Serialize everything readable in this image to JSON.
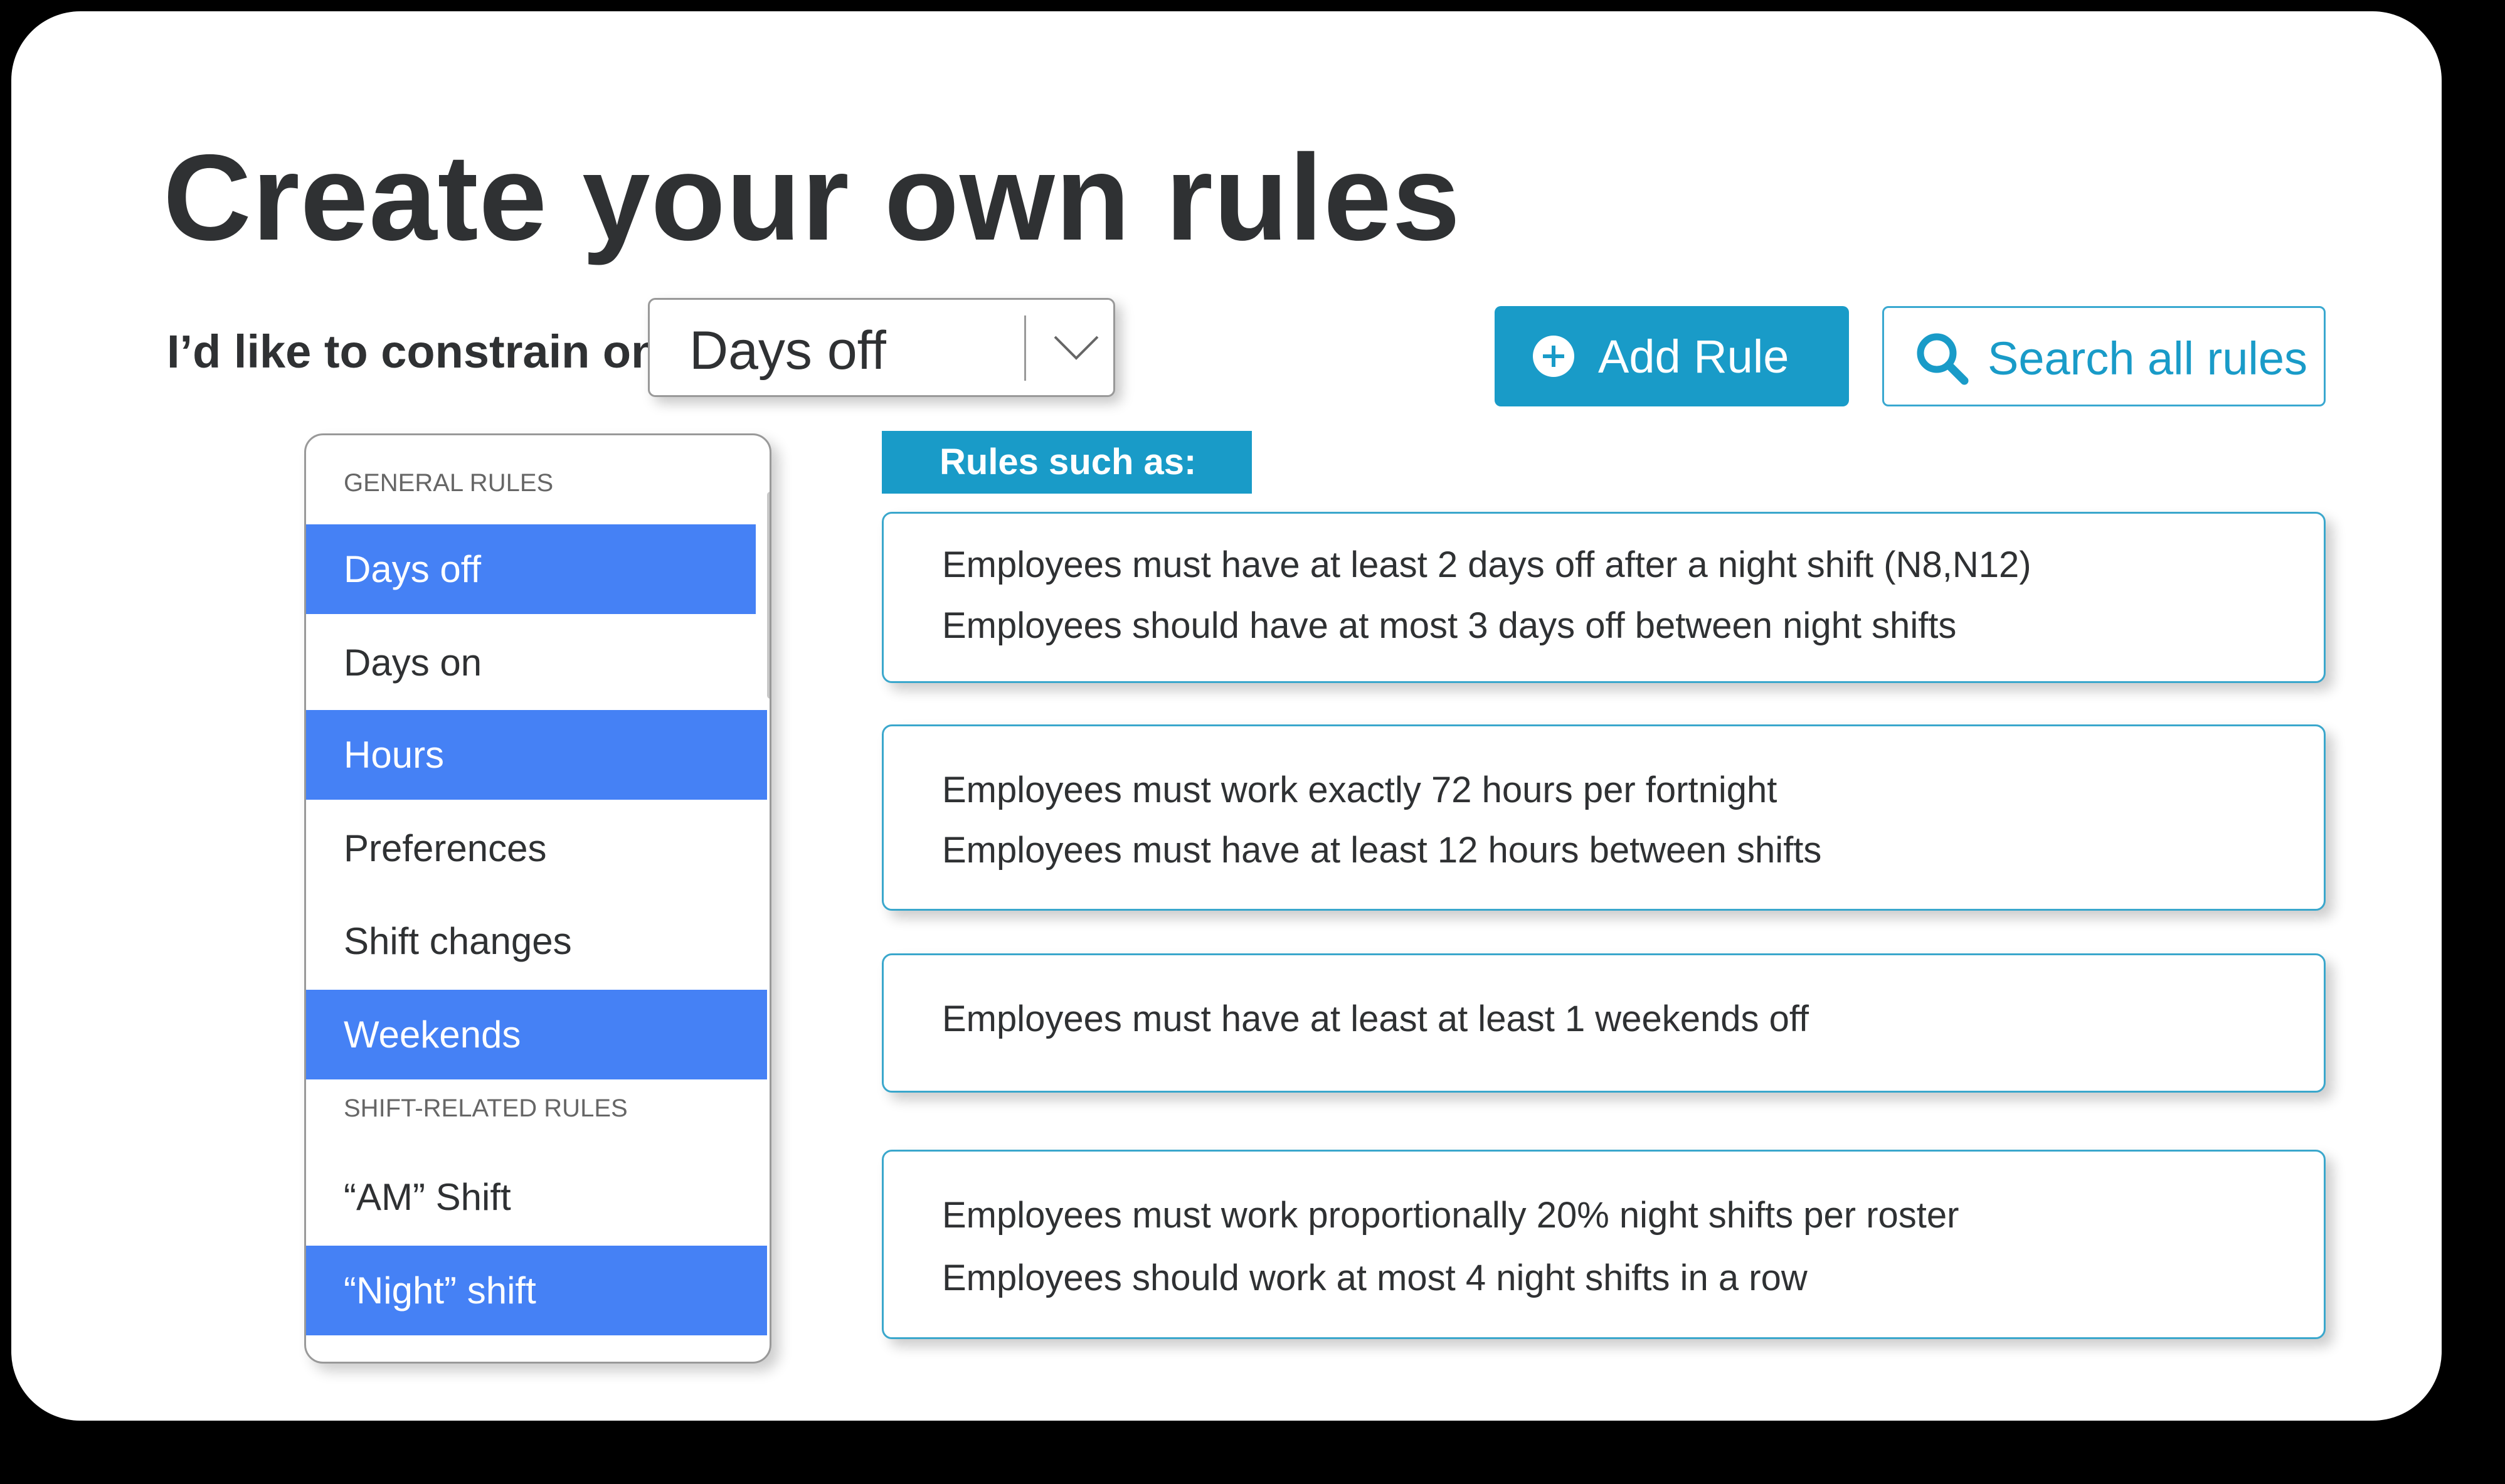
{
  "page": {
    "title": "Create your own rules"
  },
  "constraint": {
    "label": "I’d like to constrain on",
    "selected": "Days off"
  },
  "actions": {
    "add_rule": "Add Rule",
    "search_rules": "Search all rules"
  },
  "dropdown": {
    "groups": [
      {
        "header": "GENERAL RULES",
        "items": [
          {
            "label": "Days off",
            "selected": true
          },
          {
            "label": "Days on",
            "selected": false
          },
          {
            "label": "Hours",
            "selected": true
          },
          {
            "label": "Preferences",
            "selected": false
          },
          {
            "label": "Shift changes",
            "selected": false
          },
          {
            "label": "Weekends",
            "selected": true
          }
        ]
      },
      {
        "header": "SHIFT-RELATED RULES",
        "items": [
          {
            "label": "“AM” Shift",
            "selected": false
          },
          {
            "label": "“Night” shift",
            "selected": true
          }
        ]
      }
    ]
  },
  "examples": {
    "heading": "Rules such as:",
    "cards": [
      {
        "lines": [
          "Employees must have at least 2 days off after a night shift (N8,N12)",
          "Employees should have at most 3 days off between night shifts"
        ]
      },
      {
        "lines": [
          "Employees must work exactly 72 hours per fortnight",
          "Employees must have at least 12 hours between shifts"
        ]
      },
      {
        "lines": [
          "Employees must have at least at least 1 weekends off"
        ]
      },
      {
        "lines": [
          "Employees must work proportionally 20% night shifts per roster",
          "Employees should work at most 4 night shifts in a row"
        ]
      }
    ]
  },
  "colors": {
    "accent": "#199bc8",
    "selected_item": "#4581f5",
    "title_text": "#2f3133"
  },
  "icons": {
    "add": "plus-circle-icon",
    "search": "search-icon",
    "dropdown": "chevron-down-icon"
  }
}
